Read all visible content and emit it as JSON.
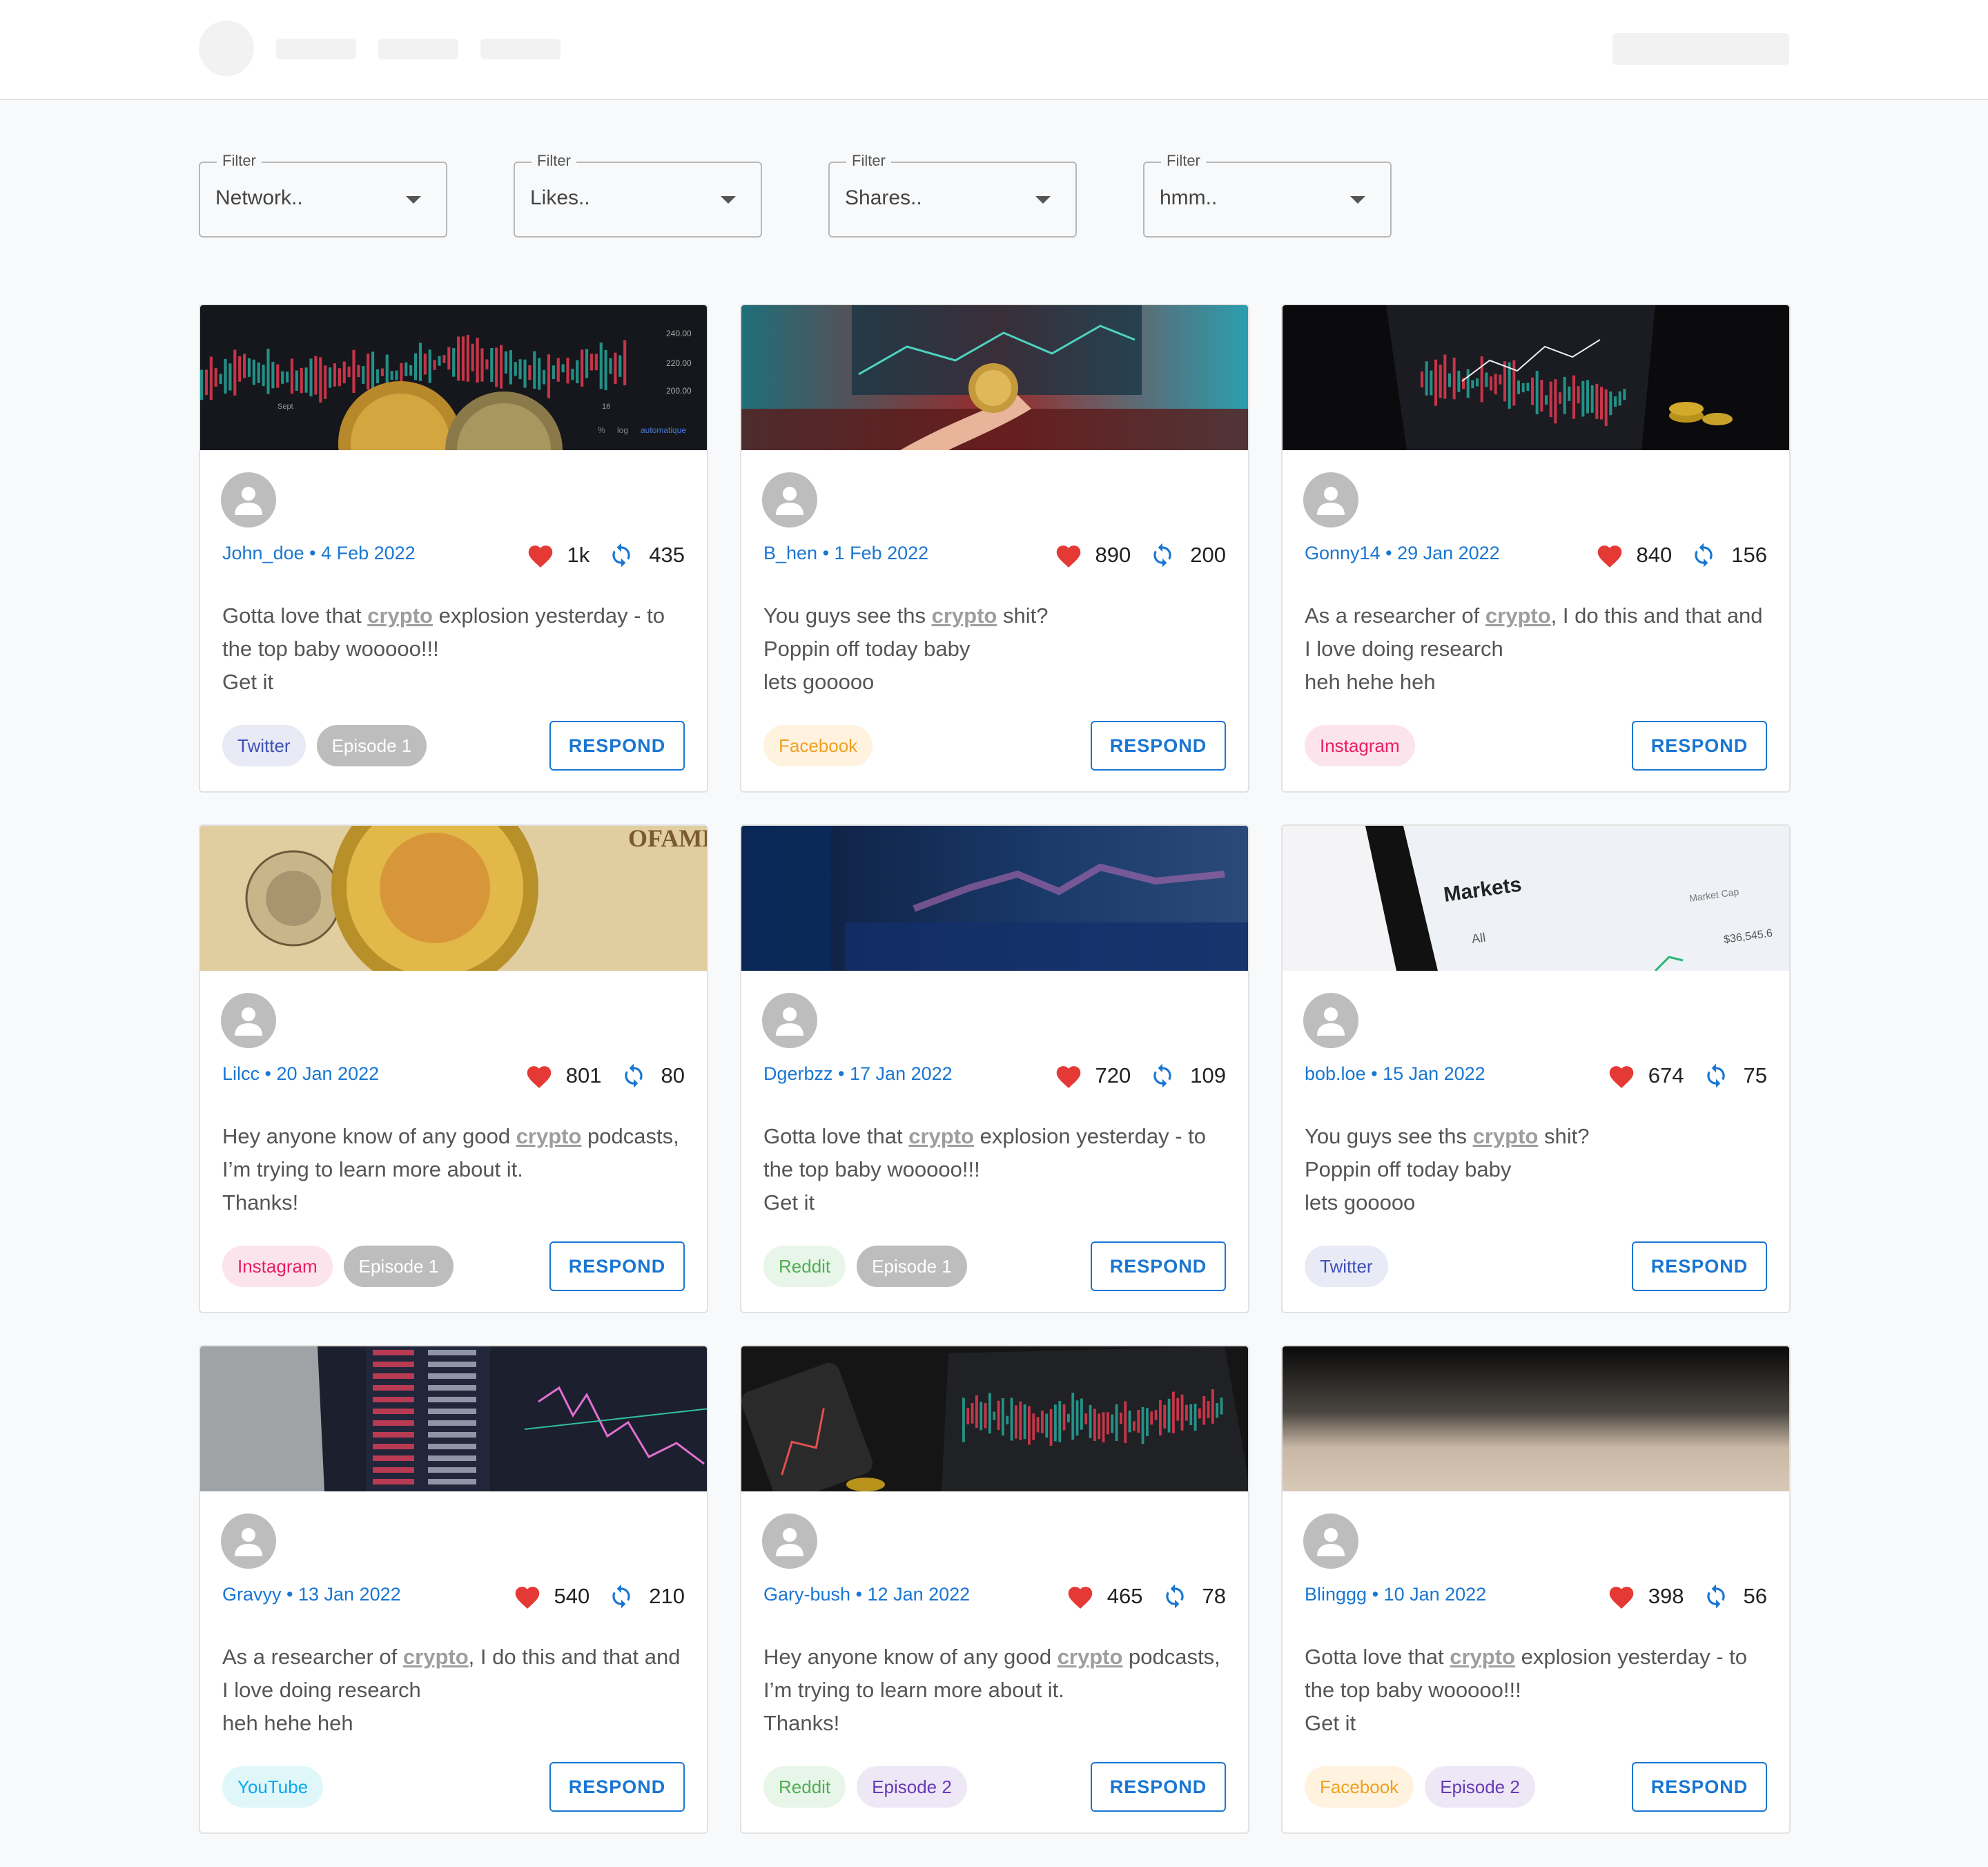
{
  "filters": [
    {
      "label": "Filter",
      "value": "Network.."
    },
    {
      "label": "Filter",
      "value": "Likes.."
    },
    {
      "label": "Filter",
      "value": "Shares.."
    },
    {
      "label": "Filter",
      "value": "hmm.."
    }
  ],
  "respond_label": "RESPOND",
  "cards": [
    {
      "user": "John_doe",
      "date": "4 Feb 2022",
      "likes": "1k",
      "shares": "435",
      "text": {
        "pre": "Gotta love that ",
        "keyword": "crypto",
        "post": " explosion yesterday - to the top baby wooooo!!!",
        "line2": "",
        "line3": "Get it"
      },
      "chips": [
        {
          "label": "Twitter",
          "kind": "twitter"
        },
        {
          "label": "Episode 1",
          "kind": "episode-grey"
        }
      ]
    },
    {
      "user": "B_hen",
      "date": "1 Feb 2022",
      "likes": "890",
      "shares": "200",
      "text": {
        "pre": "You guys see ths ",
        "keyword": "crypto",
        "post": " shit?",
        "line2": "Poppin off today baby",
        "line3": "lets gooooo"
      },
      "chips": [
        {
          "label": "Facebook",
          "kind": "facebook"
        }
      ]
    },
    {
      "user": "Gonny14",
      "date": "29 Jan 2022",
      "likes": "840",
      "shares": "156",
      "text": {
        "pre": "As a researcher of ",
        "keyword": "crypto",
        "post": ", I do this and that and I love doing research",
        "line2": "",
        "line3": "heh hehe heh"
      },
      "chips": [
        {
          "label": "Instagram",
          "kind": "instagram"
        }
      ]
    },
    {
      "user": "Lilcc",
      "date": "20 Jan 2022",
      "likes": "801",
      "shares": "80",
      "text": {
        "pre": "Hey anyone know of any good ",
        "keyword": "crypto",
        "post": " podcasts, I’m trying to learn more about it.",
        "line2": "",
        "line3": "Thanks!"
      },
      "chips": [
        {
          "label": "Instagram",
          "kind": "instagram"
        },
        {
          "label": "Episode 1",
          "kind": "episode-grey"
        }
      ]
    },
    {
      "user": "Dgerbzz",
      "date": "17 Jan 2022",
      "likes": "720",
      "shares": "109",
      "text": {
        "pre": "Gotta love that ",
        "keyword": "crypto",
        "post": " explosion yesterday - to the top baby wooooo!!!",
        "line2": "",
        "line3": "Get it"
      },
      "chips": [
        {
          "label": "Reddit",
          "kind": "reddit"
        },
        {
          "label": "Episode 1",
          "kind": "episode-grey"
        }
      ]
    },
    {
      "user": "bob.loe",
      "date": "15 Jan 2022",
      "likes": "674",
      "shares": "75",
      "text": {
        "pre": "You guys see ths ",
        "keyword": "crypto",
        "post": " shit?",
        "line2": "Poppin off today baby",
        "line3": "lets gooooo"
      },
      "chips": [
        {
          "label": "Twitter",
          "kind": "twitter"
        }
      ]
    },
    {
      "user": "Gravyy",
      "date": "13 Jan 2022",
      "likes": "540",
      "shares": "210",
      "text": {
        "pre": "As a researcher of ",
        "keyword": "crypto",
        "post": ", I do this and that and I love doing research",
        "line2": "",
        "line3": "heh hehe heh"
      },
      "chips": [
        {
          "label": "YouTube",
          "kind": "youtube"
        }
      ]
    },
    {
      "user": "Gary-bush",
      "date": "12 Jan 2022",
      "likes": "465",
      "shares": "78",
      "text": {
        "pre": "Hey anyone know of any good ",
        "keyword": "crypto",
        "post": " podcasts, I’m trying to learn more about it.",
        "line2": "",
        "line3": "Thanks!"
      },
      "chips": [
        {
          "label": "Reddit",
          "kind": "reddit"
        },
        {
          "label": "Episode 2",
          "kind": "episode-purple"
        }
      ]
    },
    {
      "user": "Blinggg",
      "date": "10 Jan 2022",
      "likes": "398",
      "shares": "56",
      "text": {
        "pre": "Gotta love that ",
        "keyword": "crypto",
        "post": " explosion yesterday - to the top baby wooooo!!!",
        "line2": "",
        "line3": "Get it"
      },
      "chips": [
        {
          "label": "Facebook",
          "kind": "facebook"
        },
        {
          "label": "Episode 2",
          "kind": "episode-purple"
        }
      ]
    }
  ],
  "image_text": {
    "chart_ticks": [
      "240.00",
      "220.00",
      "200.00"
    ],
    "chart_axis": [
      "Sept",
      "16"
    ],
    "chart_footer": [
      "%",
      "log",
      "automatique"
    ],
    "markets_title": "Markets",
    "markets_tab": "All",
    "markets_cap": "Market Cap",
    "markets_value": "$36,545.6",
    "dollar_text": "OFAME"
  },
  "colors": {
    "accent": "#1976d2",
    "heart": "#e53935",
    "share_icon": "#1976d2"
  }
}
